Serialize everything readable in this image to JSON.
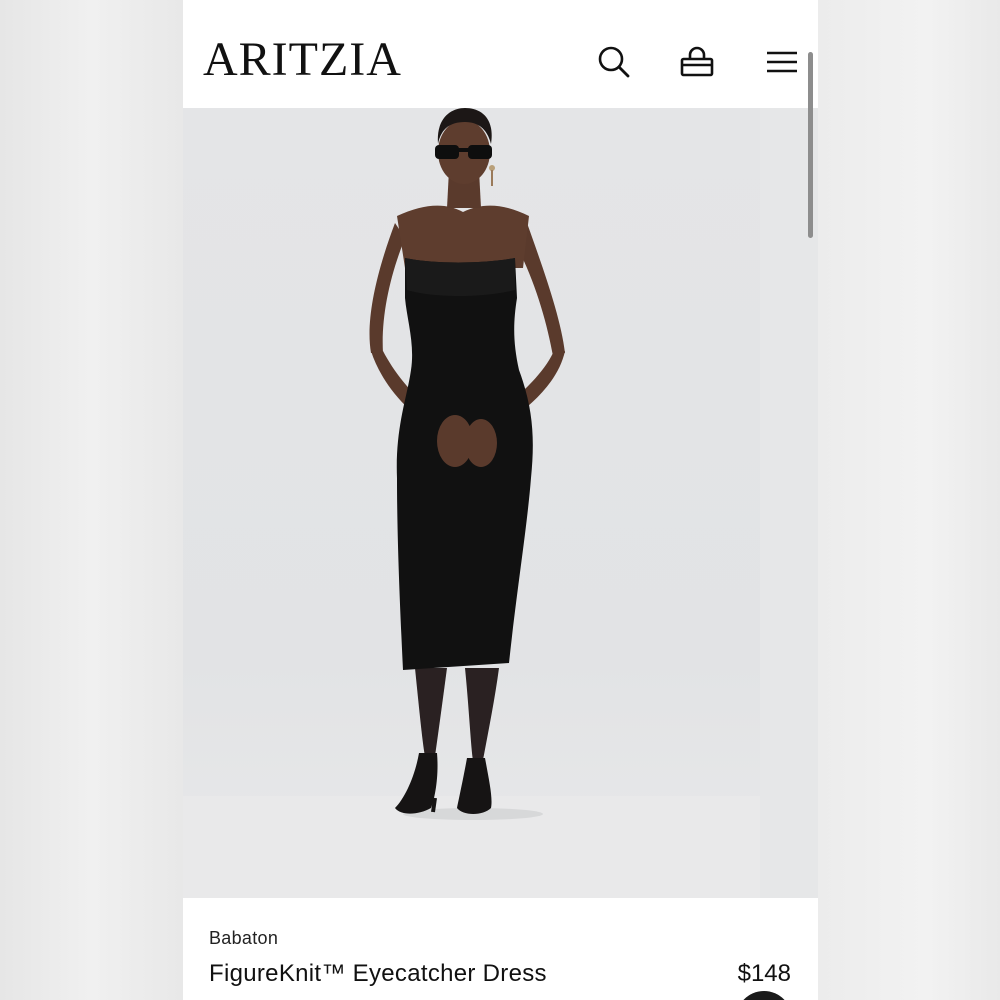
{
  "header": {
    "logo": "ARITZIA",
    "icons": [
      "search-icon",
      "shopping-bag-icon",
      "menu-icon"
    ]
  },
  "product": {
    "brand": "Babaton",
    "name": "FigureKnit™ Eyecatcher Dress",
    "price": "$148"
  },
  "colors": {
    "background": "#ffffff",
    "text": "#111111",
    "dress": "#111111",
    "hero_bg": "#e3e4e6"
  }
}
